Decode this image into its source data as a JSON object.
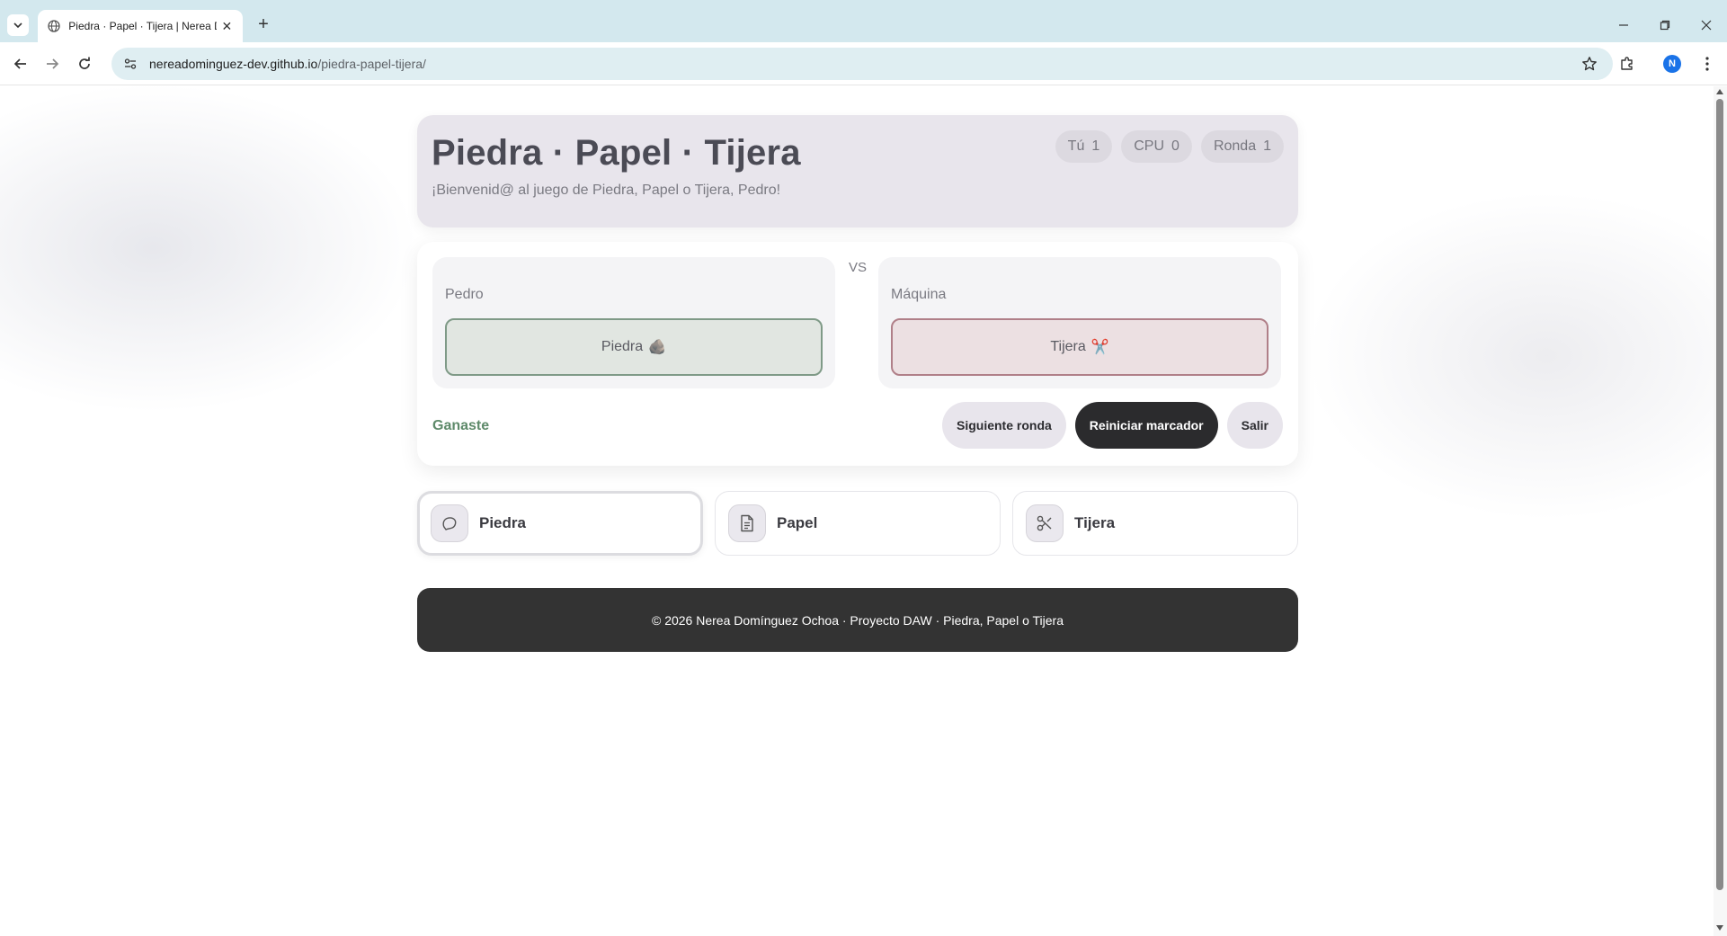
{
  "browser": {
    "tab_title": "Piedra · Papel · Tijera | Nerea Domínguez Ochoa",
    "url_host": "nereadominguez-dev.github.io",
    "url_path": "/piedra-papel-tijera/",
    "profile_initial": "N"
  },
  "header": {
    "title": "Piedra · Papel · Tijera",
    "welcome": "¡Bienvenid@ al juego de Piedra, Papel o Tijera, Pedro!",
    "scores": [
      {
        "label": "Tú",
        "value": "1"
      },
      {
        "label": "CPU",
        "value": "0"
      },
      {
        "label": "Ronda",
        "value": "1"
      }
    ]
  },
  "game": {
    "player": {
      "name": "Pedro",
      "choice": "Piedra",
      "emoji": "🪨"
    },
    "vs": "VS",
    "machine": {
      "name": "Máquina",
      "choice": "Tijera",
      "emoji": "✂️"
    },
    "result": "Ganaste",
    "actions": {
      "next_round": "Siguiente ronda",
      "reset_score": "Reiniciar marcador",
      "exit": "Salir"
    }
  },
  "options": [
    {
      "label": "Piedra",
      "icon": "rock-icon"
    },
    {
      "label": "Papel",
      "icon": "paper-icon"
    },
    {
      "label": "Tijera",
      "icon": "scissors-icon"
    }
  ],
  "footer": {
    "text": "© 2026 Nerea Domínguez Ochoa · Proyecto DAW · Piedra, Papel o Tijera"
  },
  "colors": {
    "win_accent": "#5e8a6a",
    "lose_accent": "#b07f88",
    "dark_button": "#2b2b2d"
  }
}
